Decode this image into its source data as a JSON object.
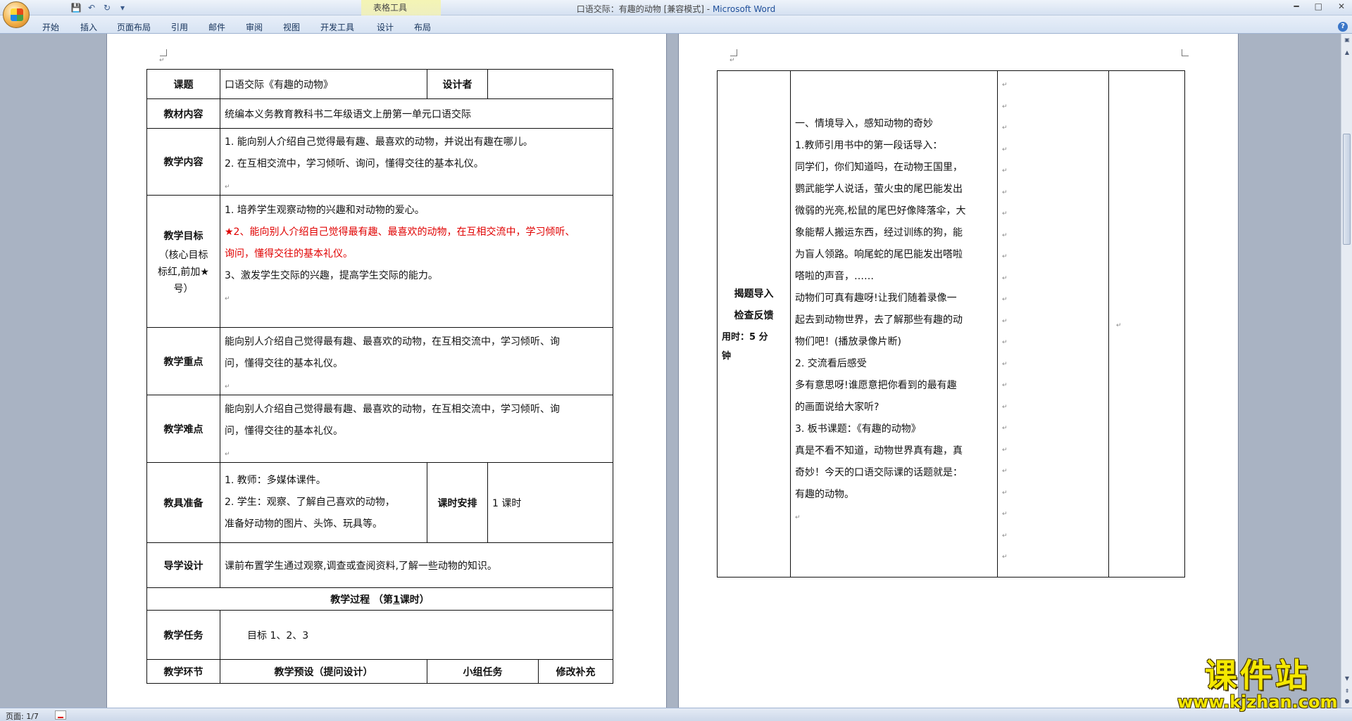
{
  "window": {
    "title": "口语交际：有趣的动物 [兼容模式]",
    "title_sep": " - ",
    "app": "Microsoft Word",
    "contextual_tab": "表格工具"
  },
  "ribbon": {
    "tabs": [
      "开始",
      "插入",
      "页面布局",
      "引用",
      "邮件",
      "审阅",
      "视图",
      "开发工具",
      "设计",
      "布局"
    ]
  },
  "qat": {
    "save_icon": "save-icon",
    "undo_icon": "undo-icon",
    "redo_icon": "redo-icon",
    "customize": "▾"
  },
  "page1": {
    "r1": {
      "h": "课题",
      "v": "口语交际《有趣的动物》",
      "h2": "设计者",
      "v2": ""
    },
    "r2": {
      "h": "教材内容",
      "v": "统编本义务教育教科书二年级语文上册第一单元口语交际"
    },
    "r3": {
      "h": "教学内容",
      "lines": [
        "1. 能向别人介绍自己觉得最有趣、最喜欢的动物，并说出有趣在哪儿。",
        "2. 在互相交流中，学习倾听、询问，懂得交往的基本礼仪。"
      ]
    },
    "r4": {
      "h": "教学目标",
      "h_note": [
        "（核心目标",
        "标红,前加★",
        "号）"
      ],
      "line1": "1. 培养学生观察动物的兴趣和对动物的爱心。",
      "red1": "★2、能向别人介绍自己觉得最有趣、最喜欢的动物，在互相交流中，学习倾听、",
      "red2": "询问，懂得交往的基本礼仪。",
      "line3": "3、激发学生交际的兴趣，提高学生交际的能力。"
    },
    "r5": {
      "h": "教学重点",
      "lines": [
        "能向别人介绍自己觉得最有趣、最喜欢的动物，在互相交流中，学习倾听、询",
        "问，懂得交往的基本礼仪。"
      ]
    },
    "r6": {
      "h": "教学难点",
      "lines": [
        "能向别人介绍自己觉得最有趣、最喜欢的动物，在互相交流中，学习倾听、询",
        "问，懂得交往的基本礼仪。"
      ]
    },
    "r7": {
      "h": "教具准备",
      "lines": [
        "1. 教师：多媒体课件。",
        "2. 学生：观察、了解自己喜欢的动物，",
        "准备好动物的图片、头饰、玩具等。"
      ],
      "h2": "课时安排",
      "v2": "1 课时"
    },
    "r8": {
      "h": "导学设计",
      "v": "课前布置学生通过观察,调查或查阅资料,了解一些动物的知识。"
    },
    "r9": {
      "pre": "教学过程 （第",
      "num": "1",
      "post": "课时）"
    },
    "r10": {
      "h": "教学任务",
      "v": "目标 1、2、3"
    },
    "r11": {
      "c1": "教学环节",
      "c2": "教学预设（提问设计）",
      "c3": "小组任务",
      "c4": "修改补充"
    }
  },
  "page2": {
    "left": {
      "l1": "揭题导入",
      "l2": "检查反馈",
      "l3": "用时：5 分",
      "l4": "钟"
    },
    "body": [
      "一、情境导入，感知动物的奇妙",
      "1.教师引用书中的第一段话导入：",
      "同学们，你们知道吗，在动物王国里，",
      "鹦武能学人说话，萤火虫的尾巴能发出",
      "微弱的光亮,松鼠的尾巴好像降落伞，大",
      "象能帮人搬运东西，经过训练的狗，能",
      "为盲人领路。响尾蛇的尾巴能发出嗒啦",
      "嗒啦的声音，……",
      "动物们可真有趣呀!让我们随着录像一",
      "起去到动物世界，去了解那些有趣的动",
      "物们吧！(播放录像片断)",
      "2. 交流看后感受",
      "多有意思呀!谁愿意把你看到的最有趣",
      "的画面说给大家听?",
      "3. 板书课题：《有趣的动物》",
      "真是不看不知道，动物世界真有趣，真",
      "奇妙！今天的口语交际课的话题就是：",
      "有趣的动物。"
    ]
  },
  "status": {
    "page": "页面: 1/7"
  },
  "watermark": {
    "title": "课件站",
    "url": "www.kjzhan.com"
  }
}
